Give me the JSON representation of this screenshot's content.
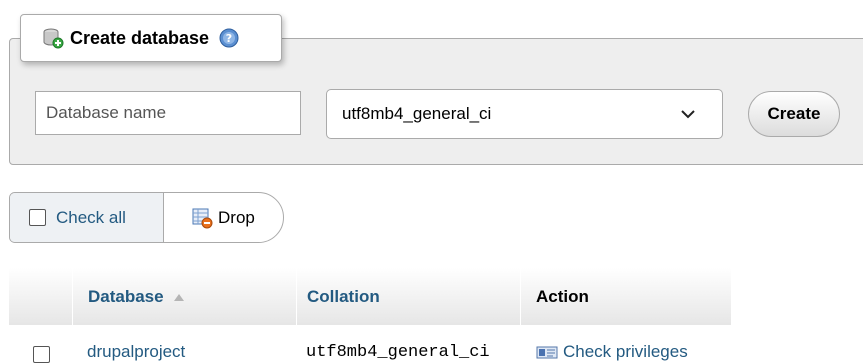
{
  "create_panel": {
    "title": "Create database",
    "name_placeholder": "Database name",
    "collation_selected": "utf8mb4_general_ci",
    "create_label": "Create"
  },
  "toolbar": {
    "check_all_label": "Check all",
    "drop_label": "Drop"
  },
  "table": {
    "headers": {
      "database": "Database",
      "collation": "Collation",
      "action": "Action"
    },
    "rows": [
      {
        "database": "drupalproject",
        "collation": "utf8mb4_general_ci",
        "action": "Check privileges"
      }
    ]
  },
  "colors": {
    "link": "#235a81",
    "panel_bg": "#eeeeee",
    "border": "#aaaaaa"
  },
  "icons": {
    "legend": "database-add-icon",
    "help": "help-icon",
    "drop": "drop-icon",
    "sort": "sort-ascending-icon",
    "privileges": "privileges-icon"
  }
}
